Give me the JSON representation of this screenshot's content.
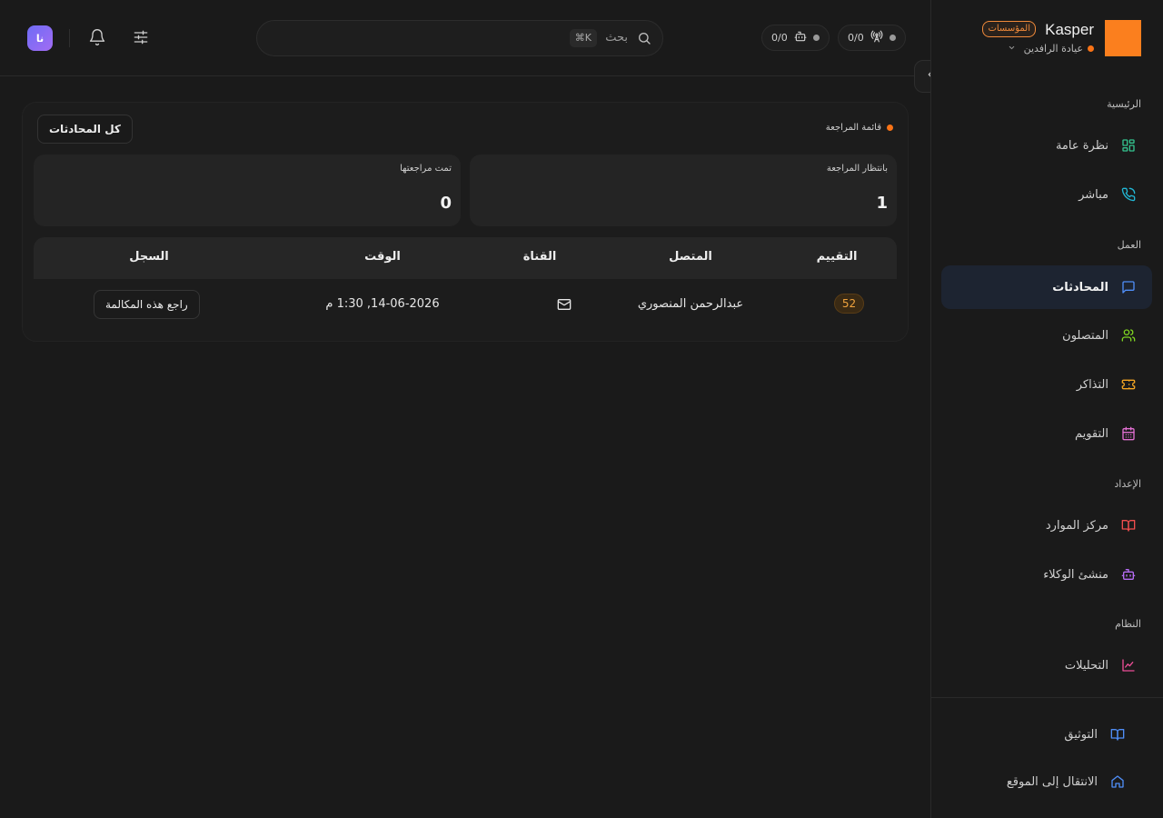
{
  "brand": {
    "name": "Kasper",
    "badge": "المؤسسات",
    "clinic": "عيادة الرافدين",
    "logo_color": "#fb7f1e"
  },
  "topbar": {
    "avatar_initials": "نا",
    "search_placeholder": "بحث",
    "search_shortcut": "⌘K",
    "status_pills": [
      {
        "value": "0/0",
        "icon": "antenna-icon"
      },
      {
        "value": "0/0",
        "icon": "bot-icon"
      }
    ]
  },
  "sidebar": {
    "sections": [
      {
        "label": "الرئيسية"
      },
      {
        "label": "العمل"
      },
      {
        "label": "الإعداد"
      },
      {
        "label": "النظام"
      }
    ],
    "items": [
      {
        "label": "نظرة عامة",
        "icon": "grid-icon"
      },
      {
        "label": "مباشر",
        "icon": "phone-icon"
      },
      {
        "label": "المحادثات",
        "icon": "chat-icon",
        "active": true
      },
      {
        "label": "المتصلون",
        "icon": "users-icon"
      },
      {
        "label": "التذاكر",
        "icon": "ticket-icon"
      },
      {
        "label": "التقويم",
        "icon": "calendar-icon"
      },
      {
        "label": "مركز الموارد",
        "icon": "book-icon"
      },
      {
        "label": "منشئ الوكلاء",
        "icon": "bot-icon"
      },
      {
        "label": "التحليلات",
        "icon": "chart-icon"
      }
    ],
    "footer": [
      {
        "label": "التوثيق",
        "icon": "book-open-icon"
      },
      {
        "label": "الانتقال إلى الموقع",
        "icon": "home-icon"
      }
    ]
  },
  "panel": {
    "title": "قائمة المراجعة",
    "all_button": "كل المحادثات",
    "stats": [
      {
        "label": "بانتظار المراجعة",
        "value": "1"
      },
      {
        "label": "تمت مراجعتها",
        "value": "0"
      }
    ],
    "table": {
      "headers": [
        "التقييم",
        "المتصل",
        "القناة",
        "الوقت",
        "السجل"
      ],
      "rows": [
        {
          "score": "52",
          "caller": "عبدالرحمن المنصوري",
          "channel": "mail-icon",
          "time": "14-06-2026, 1:30 م",
          "action": "راجع هذه المكالمة"
        }
      ]
    }
  },
  "colors": {
    "accent": "#f97316",
    "active_bg": "#1d2431",
    "score": "#f0a33e"
  }
}
